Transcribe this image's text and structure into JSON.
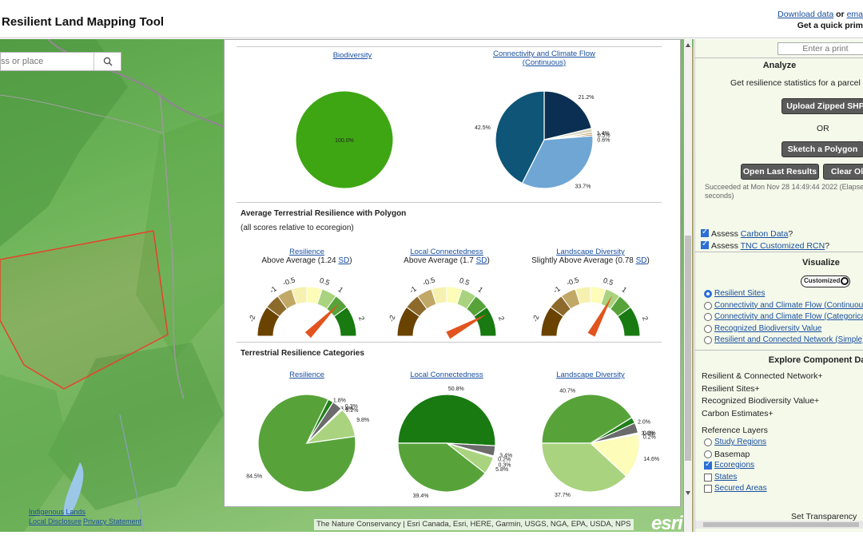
{
  "header": {
    "title": "Resilient Land Mapping Tool",
    "download_link": "Download data",
    "or_text": "or",
    "email_link": "ema",
    "print_text": "Get a quick prim"
  },
  "map": {
    "search_placeholder": "ss or place",
    "links": [
      "Indigenous Lands",
      "Local Disclosure",
      "Privacy Statement"
    ],
    "attribution": "The Nature Conservancy | Esri Canada, Esri, HERE, Garmin, USGS, NGA, EPA, USDA, NPS",
    "esri": "esri",
    "polygon_color": "#e8412b"
  },
  "popup": {
    "top_charts": [
      {
        "title": "Biodiversity",
        "slices": [
          {
            "label": "100.0%",
            "value": 100.0,
            "color": "#3ea613"
          }
        ]
      },
      {
        "title": "Connectivity and Climate Flow (Continuous)",
        "slices": [
          {
            "label": "21.2%",
            "value": 21.2,
            "color": "#0b2f52"
          },
          {
            "label": "1.4%",
            "value": 1.4,
            "color": "#d9d9c2"
          },
          {
            "label": "0.6%",
            "value": 0.6,
            "color": "#b58a3a"
          },
          {
            "label": "0.5%",
            "value": 0.5,
            "color": "#8a5a10"
          },
          {
            "label": "33.7%",
            "value": 33.7,
            "color": "#6fa6d4"
          },
          {
            "label": "42.5%",
            "value": 42.5,
            "color": "#0e5577"
          }
        ]
      }
    ],
    "avg_section": {
      "title": "Average Terrestrial Resilience with Polygon",
      "note": "(all scores relative to ecoregion)",
      "gauges": [
        {
          "title": "Resilience",
          "desc": "Above Average (1.24",
          "sd": "SD",
          "close": ")",
          "value": 1.24
        },
        {
          "title": "Local Connectedness",
          "desc": "Above Average (1.7",
          "sd": "SD",
          "close": ")",
          "value": 1.7
        },
        {
          "title": "Landscape Diversity",
          "desc": "Slightly Above Average (0.78",
          "sd": "SD",
          "close": ")",
          "value": 0.78
        }
      ],
      "tick_labels": [
        "-2",
        "-1",
        "-0.5",
        "0.5",
        "1",
        "2"
      ]
    },
    "cat_section": {
      "title": "Terrestrial Resilience Categories",
      "charts": [
        {
          "title": "Resilience",
          "slices": [
            {
              "label": "84.5%",
              "value": 84.5,
              "color": "#57a33a"
            },
            {
              "label": "1.8%",
              "value": 1.8,
              "color": "#1f7f1a"
            },
            {
              "label": "3.4%",
              "value": 3.4,
              "color": "#6b6b6b"
            },
            {
              "label": "0.3%",
              "value": 0.3,
              "color": "#d8c27a"
            },
            {
              "label": "0.2%",
              "value": 0.2,
              "color": "#a87a2a"
            },
            {
              "label": "9.8%",
              "value": 9.8,
              "color": "#a9d37e"
            }
          ]
        },
        {
          "title": "Local Connectedness",
          "slices": [
            {
              "label": "50.8%",
              "value": 50.8,
              "color": "#187a11"
            },
            {
              "label": "3.4%",
              "value": 3.4,
              "color": "#6b6b6b"
            },
            {
              "label": "0.3%",
              "value": 0.3,
              "color": "#d8c27a"
            },
            {
              "label": "0.2%",
              "value": 0.2,
              "color": "#a87a2a"
            },
            {
              "label": "5.8%",
              "value": 5.8,
              "color": "#a9d37e"
            },
            {
              "label": "39.4%",
              "value": 39.4,
              "color": "#57a33a"
            }
          ]
        },
        {
          "title": "Landscape Diversity",
          "slices": [
            {
              "label": "40.7%",
              "value": 40.7,
              "color": "#57a33a"
            },
            {
              "label": "2.0%",
              "value": 2.0,
              "color": "#1f7f1a"
            },
            {
              "label": "3.4%",
              "value": 3.4,
              "color": "#6b6b6b"
            },
            {
              "label": "0.3%",
              "value": 0.3,
              "color": "#d8c27a"
            },
            {
              "label": "0.2%",
              "value": 0.2,
              "color": "#a87a2a"
            },
            {
              "label": "14.6%",
              "value": 14.6,
              "color": "#fdfcb8"
            },
            {
              "label": "37.7%",
              "value": 37.7,
              "color": "#a9d37e"
            }
          ]
        }
      ]
    }
  },
  "panel": {
    "print_placeholder": "Enter a print",
    "analyze_head": "Analyze",
    "analyze_text": "Get resilience statistics for a parcel or",
    "upload_btn": "Upload Zipped SHP",
    "or": "OR",
    "sketch_btn": "Sketch a Polygon",
    "open_last_btn": "Open Last Results",
    "clear_btn": "Clear Ol",
    "status": "Succeeded at Mon Nov 28 14:49:44 2022 (Elapse",
    "status2": "seconds)",
    "assess_carbon_prefix": "Assess",
    "assess_carbon_link": "Carbon Data",
    "assess_carbon_suffix": "?",
    "assess_rcn_prefix": "Assess",
    "assess_rcn_link": "TNC Customized RCN",
    "assess_rcn_suffix": "?",
    "visualize_head": "Visualize",
    "toggle_label": "Customized",
    "visualize_options": [
      "Resilient Sites",
      "Connectivity and Climate Flow (Continuous)",
      "Connectivity and Climate Flow (Categorical)",
      "Recognized Biodiversity Value",
      "Resilient and Connected Network (Simple)"
    ],
    "explore_head": "Explore Component Data",
    "explore_items": [
      "Resilient & Connected Network+",
      "Resilient Sites+",
      "Recognized Biodiversity Value+",
      "Carbon Estimates+"
    ],
    "reference_head": "Reference Layers",
    "reference_items": [
      {
        "label": "Study Regions",
        "kind": "radio",
        "on": false
      },
      {
        "label": "Basemap",
        "kind": "radio",
        "on": false
      },
      {
        "label": "Ecoregions",
        "kind": "check",
        "on": true
      },
      {
        "label": "States",
        "kind": "check",
        "on": false
      },
      {
        "label": "Secured Areas",
        "kind": "check",
        "on": false
      }
    ],
    "transparency": "Set Transparency"
  }
}
